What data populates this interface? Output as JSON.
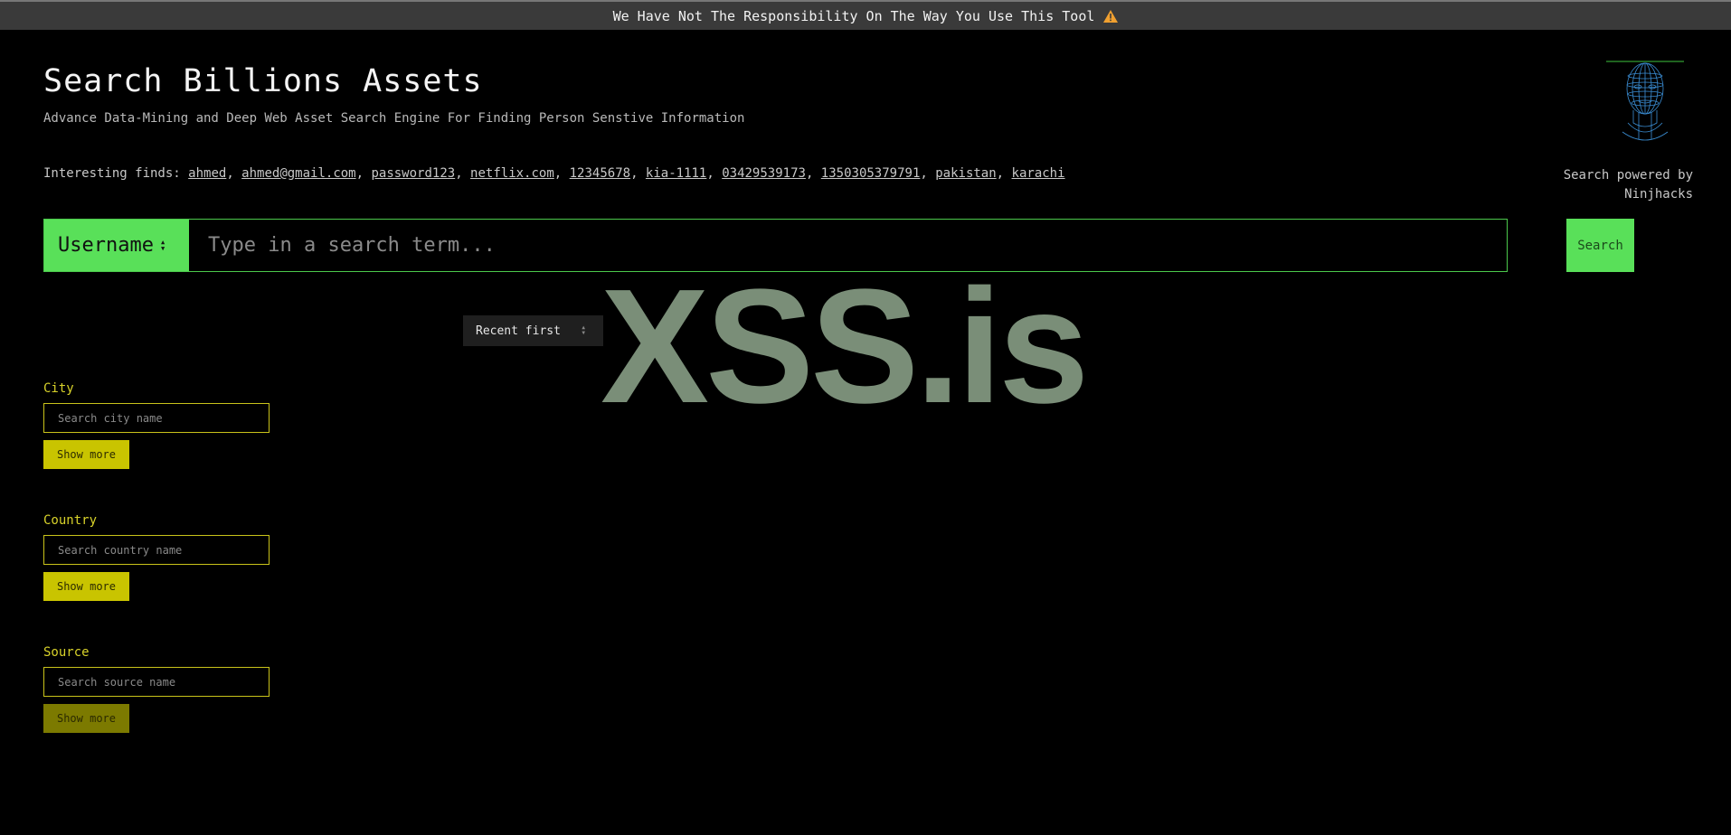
{
  "banner": {
    "text": "We Have Not The Responsibility On The Way You Use This Tool"
  },
  "header": {
    "title": "Search Billions Assets",
    "subtitle": "Advance Data-Mining and Deep Web Asset Search Engine For Finding Person Senstive Information"
  },
  "finds": {
    "label": "Interesting finds:",
    "items": [
      "ahmed",
      "ahmed@gmail.com",
      "password123",
      "netflix.com",
      "12345678",
      "kia-1111",
      "03429539173",
      "1350305379791",
      "pakistan",
      "karachi"
    ]
  },
  "powered": {
    "line1": "Search powered by",
    "line2": "Ninjhacks"
  },
  "search": {
    "type_label": "Username",
    "placeholder": "Type in a search term...",
    "button_label": "Search"
  },
  "sort": {
    "label": "Recent first"
  },
  "watermark": "XSS.is",
  "facets": {
    "city": {
      "label": "City",
      "placeholder": "Search city name",
      "button": "Show more"
    },
    "country": {
      "label": "Country",
      "placeholder": "Search country name",
      "button": "Show more"
    },
    "source": {
      "label": "Source",
      "placeholder": "Search source name",
      "button": "Show more"
    }
  },
  "colors": {
    "accent_green": "#59e059",
    "facet_yellow": "#c9c400",
    "warning_orange": "#f0a030"
  }
}
